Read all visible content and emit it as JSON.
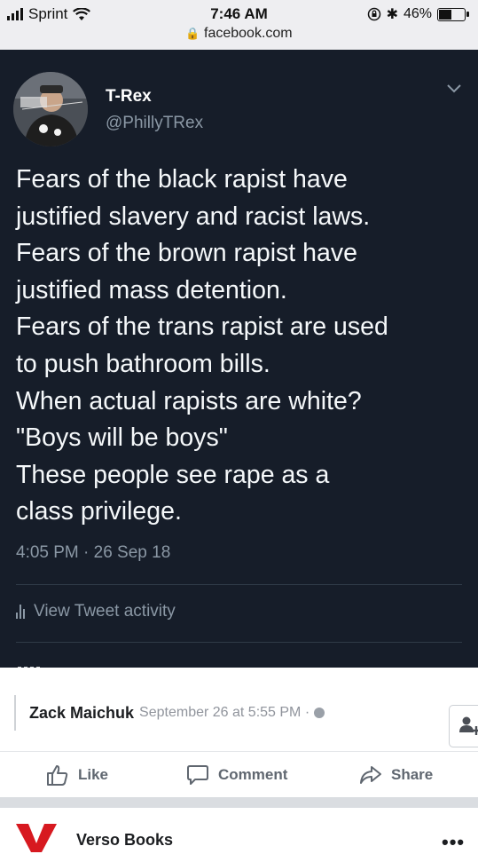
{
  "status_bar": {
    "carrier": "Sprint",
    "time": "7:46 AM",
    "battery": "46%",
    "url": "facebook.com"
  },
  "tweet": {
    "display_name": "T-Rex",
    "handle": "@PhillyTRex",
    "lines": [
      "Fears of the black rapist have",
      "justified slavery and racist laws.",
      "Fears of the brown rapist have",
      "justified mass detention.",
      "Fears of the trans rapist are used",
      "to push bathroom bills.",
      "When actual rapists are white?",
      "\"Boys will be boys\"",
      "These people see rape as a",
      "class privilege."
    ],
    "timestamp": "4:05 PM · 26 Sep 18",
    "activity_label": "View Tweet activity",
    "colors": {
      "background": "#161d29",
      "text": "#f5f8fa",
      "muted": "#8b98a5"
    }
  },
  "facebook": {
    "attribution_author": "Zack Maichuk",
    "attribution_date": "September 26 at 5:55 PM ·",
    "actions": {
      "like": "Like",
      "comment": "Comment",
      "share": "Share"
    },
    "next_post_author": "Verso Books",
    "more_label": "•••",
    "colors": {
      "action_text": "#606770",
      "verso_red": "#d71920"
    }
  }
}
